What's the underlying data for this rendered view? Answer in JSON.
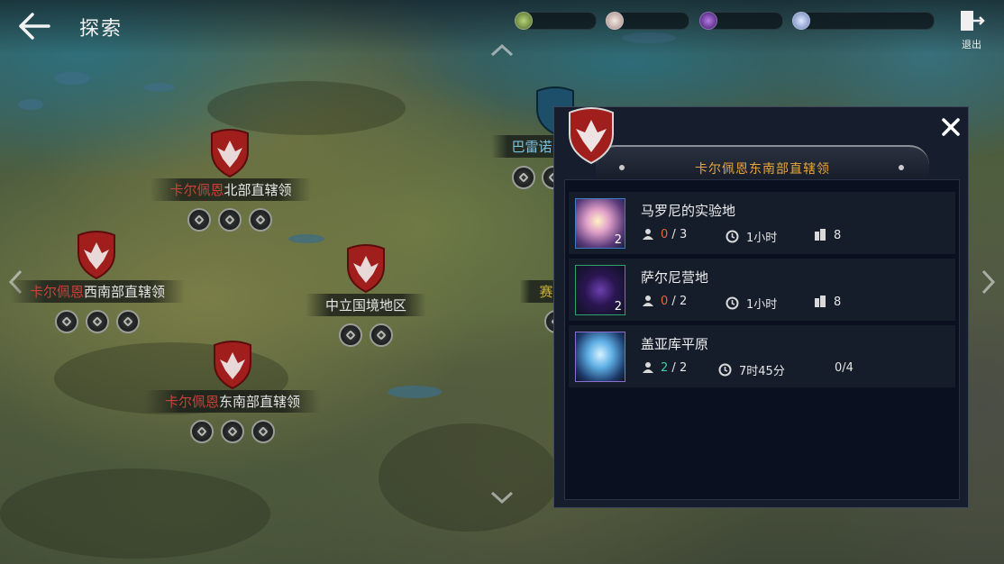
{
  "header": {
    "title": "探索",
    "exit_label": "退出"
  },
  "resources": [
    {
      "icon": "green-crystal-icon",
      "value": ""
    },
    {
      "icon": "pearl-orb-icon",
      "value": ""
    },
    {
      "icon": "purple-orb-icon",
      "value": ""
    },
    {
      "icon": "blue-coin-icon",
      "value": ""
    }
  ],
  "map": {
    "regions": [
      {
        "name_red": "卡尔佩恩",
        "name_rest": "北部直辖领"
      },
      {
        "name_red": "卡尔佩恩",
        "name_rest": "西南部直辖领"
      },
      {
        "name_red": "",
        "name_rest": "中立国境地区"
      },
      {
        "name_red": "卡尔佩恩",
        "name_rest": "东南部直辖领"
      },
      {
        "name_red": "",
        "name_rest": "巴雷诺"
      },
      {
        "name_red": "",
        "name_rest": "赛"
      }
    ]
  },
  "panel": {
    "title": "卡尔佩恩东南部直辖领",
    "dungeons": [
      {
        "name": "马罗尼的实验地",
        "count": "2",
        "party_current": "0",
        "party_max": "3",
        "time": "1小时",
        "reward": "8"
      },
      {
        "name": "萨尔尼营地",
        "count": "2",
        "party_current": "0",
        "party_max": "2",
        "time": "1小时",
        "reward": "8"
      },
      {
        "name": "盖亚库平原",
        "count": "",
        "party_current": "2",
        "party_max": "2",
        "time": "7时45分",
        "reward": "0/4"
      }
    ]
  },
  "colors": {
    "accent_gold": "#e8a63a",
    "party_zero": "#e8663e",
    "party_full": "#3fd0a8",
    "region_red": "#c8423a"
  }
}
